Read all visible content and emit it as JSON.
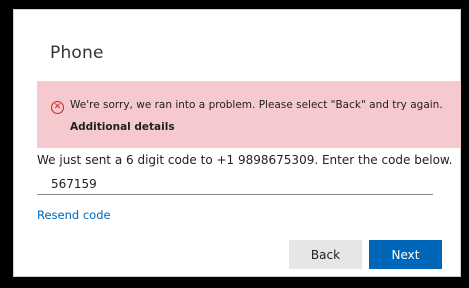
{
  "page": {
    "title": "Phone"
  },
  "error": {
    "icon": "error-circle-x-icon",
    "message": "We're sorry, we ran into a problem. Please select \"Back\" and try again.",
    "details_link": "Additional details",
    "colors": {
      "background": "#f5c9cd",
      "icon": "#c4262e"
    }
  },
  "verification": {
    "message": "We just sent a 6 digit code to +1 9898675309. Enter the code below.",
    "code_value": "567159",
    "resend_label": "Resend code"
  },
  "buttons": {
    "back_label": "Back",
    "next_label": "Next"
  },
  "colors": {
    "accent": "#0067b8"
  }
}
